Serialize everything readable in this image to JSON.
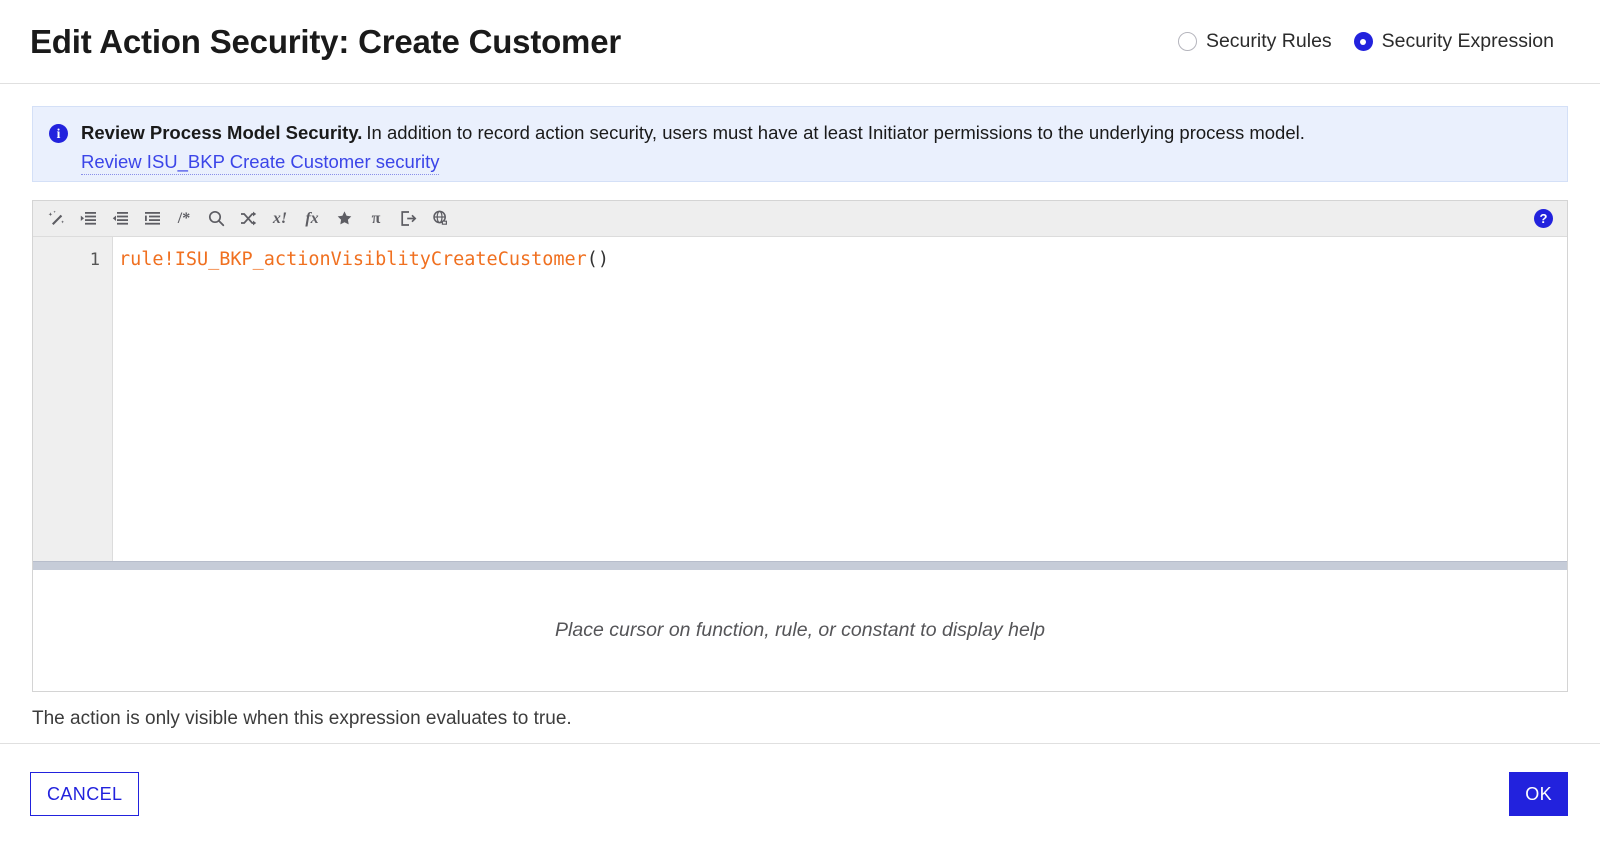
{
  "header": {
    "title": "Edit Action Security: Create Customer",
    "mode_options": [
      {
        "label": "Security Rules",
        "selected": false
      },
      {
        "label": "Security Expression",
        "selected": true
      }
    ]
  },
  "banner": {
    "icon": "info-icon",
    "strong_text": "Review Process Model Security.",
    "body_text": "In addition to record action security, users must have at least Initiator permissions to the underlying process model.",
    "link_text": "Review ISU_BKP Create Customer security"
  },
  "toolbar": {
    "items": [
      {
        "name": "magic-wand-icon",
        "title": "Format expression"
      },
      {
        "name": "outdent-icon",
        "title": "Outdent"
      },
      {
        "name": "indent-icon",
        "title": "Indent"
      },
      {
        "name": "align-lines-icon",
        "title": "Format lines"
      },
      {
        "name": "comment-icon",
        "title": "Comment",
        "glyph": "/*"
      },
      {
        "name": "search-icon",
        "title": "Find"
      },
      {
        "name": "shuffle-icon",
        "title": "Swap"
      },
      {
        "name": "variable-icon",
        "title": "Variables",
        "glyph": "x!"
      },
      {
        "name": "function-icon",
        "title": "Functions",
        "glyph": "fx"
      },
      {
        "name": "star-icon",
        "title": "Favorites"
      },
      {
        "name": "pi-icon",
        "title": "Constants",
        "glyph": "π"
      },
      {
        "name": "export-icon",
        "title": "Export"
      },
      {
        "name": "globe-icon",
        "title": "Internationalization"
      }
    ],
    "help_glyph": "?"
  },
  "editor": {
    "line_number": "1",
    "code_rule": "rule!ISU_BKP_actionVisiblityCreateCustomer",
    "code_parens": "()",
    "help_placeholder": "Place cursor on function, rule, or constant to display help",
    "caption": "The action is only visible when this expression evaluates to true."
  },
  "footer": {
    "cancel_label": "CANCEL",
    "ok_label": "OK"
  },
  "colors": {
    "accent": "#2222dd",
    "banner_bg": "#eaf0fd",
    "toolbar_bg": "#eeeeee",
    "gutter_bg": "#efefef",
    "code_rule": "#f07020",
    "splitter": "#c6ccd8"
  }
}
